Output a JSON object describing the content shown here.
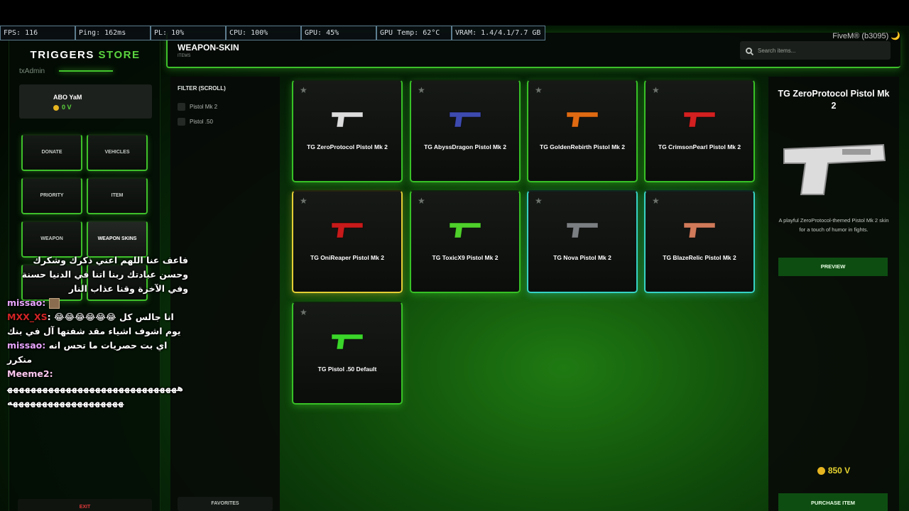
{
  "perf": [
    "FPS: 116",
    "Ping: 162ms",
    "PL: 10%",
    "CPU: 100%",
    "GPU: 45%",
    "GPU Temp: 62°C",
    "VRAM: 1.4/4.1/7.7 GB"
  ],
  "client_label": "FiveM® (b3095) 🌙",
  "ghost_label": "txAdmin",
  "brand": {
    "part1": "TRIGGERS",
    "part2": "STORE"
  },
  "user": {
    "name": "ABO YaM",
    "balance": "0 V"
  },
  "categories": [
    "DONATE",
    "VEHICLES",
    "PRIORITY",
    "ITEM",
    "WEAPON",
    "WEAPON SKINS"
  ],
  "exit_label": "EXIT",
  "header": {
    "title": "WEAPON-SKIN",
    "subtitle": "ITEMS",
    "search_placeholder": "Search items..."
  },
  "filter": {
    "title": "FILTER (SCROLL)",
    "options": [
      "Pistol Mk 2",
      "Pistol .50"
    ],
    "favorites_label": "FAVORITES"
  },
  "items": [
    {
      "name": "TG ZeroProtocol Pistol Mk 2",
      "color": "#dcdcdc",
      "rarity": "common"
    },
    {
      "name": "TG AbyssDragon Pistol Mk 2",
      "color": "#3d4bb0",
      "rarity": "common"
    },
    {
      "name": "TG GoldenRebirth Pistol Mk 2",
      "color": "#e06a12",
      "rarity": "common"
    },
    {
      "name": "TG CrimsonPearl Pistol Mk 2",
      "color": "#d42020",
      "rarity": "common"
    },
    {
      "name": "TG OniReaper Pistol Mk 2",
      "color": "#c81a1a",
      "rarity": "legendary"
    },
    {
      "name": "TG ToxicX9 Pistol Mk 2",
      "color": "#4fd02a",
      "rarity": "common"
    },
    {
      "name": "TG Nova Pistol Mk 2",
      "color": "#7c7f82",
      "rarity": "rare"
    },
    {
      "name": "TG BlazeRelic Pistol Mk 2",
      "color": "#d07a5a",
      "rarity": "rare"
    },
    {
      "name": "TG Pistol .50 Default",
      "color": "#3bd62a",
      "rarity": "common"
    }
  ],
  "details": {
    "title": "TG ZeroProtocol Pistol Mk 2",
    "description": "A playful ZeroProtocol-themed Pistol Mk 2 skin for a touch of humor in fights.",
    "preview_label": "PREVIEW",
    "price": "850 V",
    "purchase_label": "PURCHASE ITEM"
  },
  "chat": [
    {
      "name": "",
      "text": "فاعف عنا اللهم اعني ذكرك وشكرك وحسن عبادتك ربنا اتنا في الدنيا حسنة وفي الآخرة وقنا عذاب النار"
    },
    {
      "name": "missao:",
      "text": ""
    },
    {
      "name": "MXX_XS",
      "text": ": 😂😂😂😂😂😂 انا جالس كل يوم اشوف اشياء مقد شفتها آل في بنك"
    },
    {
      "name": "missao:",
      "text": "اي بت حصريات ما تحس انه منكرر"
    },
    {
      "name": "Meeme2:",
      "text": "هههههههههههههههههههههههههههههههههههههههههههههههههه"
    }
  ]
}
